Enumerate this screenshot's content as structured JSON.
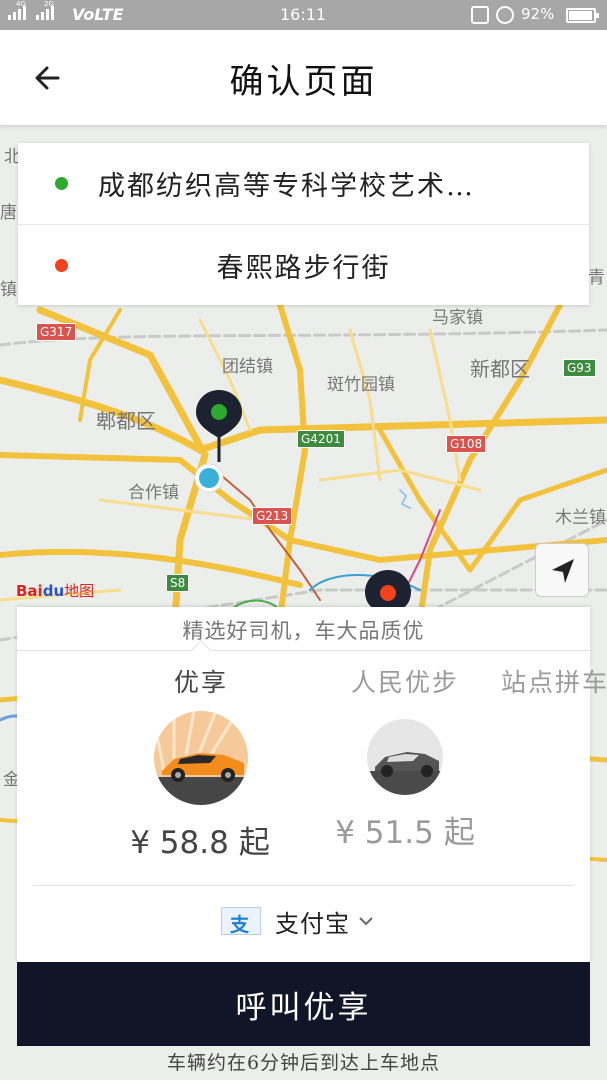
{
  "status_bar": {
    "net_1": "4G",
    "net_2": "2G",
    "volte": "VoLTE",
    "time": "16:11",
    "battery": "92%"
  },
  "header": {
    "title": "确认页面"
  },
  "route": {
    "origin": "成都纺织高等专科学校艺术…",
    "destination": "春熙路步行街",
    "origin_color": "#2daa2d",
    "destination_color": "#f0421c"
  },
  "map": {
    "places": [
      "团结镇",
      "马家镇",
      "新都区",
      "斑竹园镇",
      "郫都区",
      "合作镇",
      "木兰镇",
      "唐",
      "北",
      "镇",
      "青",
      "金"
    ],
    "road_signs": [
      "G317",
      "G4201",
      "G108",
      "G213",
      "G93",
      "S8"
    ],
    "logo": "地图",
    "logo_brand_1": "Bai",
    "logo_brand_2": "du"
  },
  "sheet": {
    "slogan": "精选好司机，车大品质优",
    "cars": [
      {
        "name": "优享",
        "currency": "¥",
        "price": "58.8",
        "suffix": "起",
        "selected": true
      },
      {
        "name": "人民优步",
        "currency": "¥",
        "price": "51.5",
        "suffix": "起",
        "selected": false
      },
      {
        "name": "站点拼车",
        "selected": false
      }
    ],
    "payment": {
      "icon_char": "支",
      "label": "支付宝"
    }
  },
  "call_button": "呼叫优享",
  "eta": "车辆约在6分钟后到达上车地点",
  "accent": "#111528"
}
